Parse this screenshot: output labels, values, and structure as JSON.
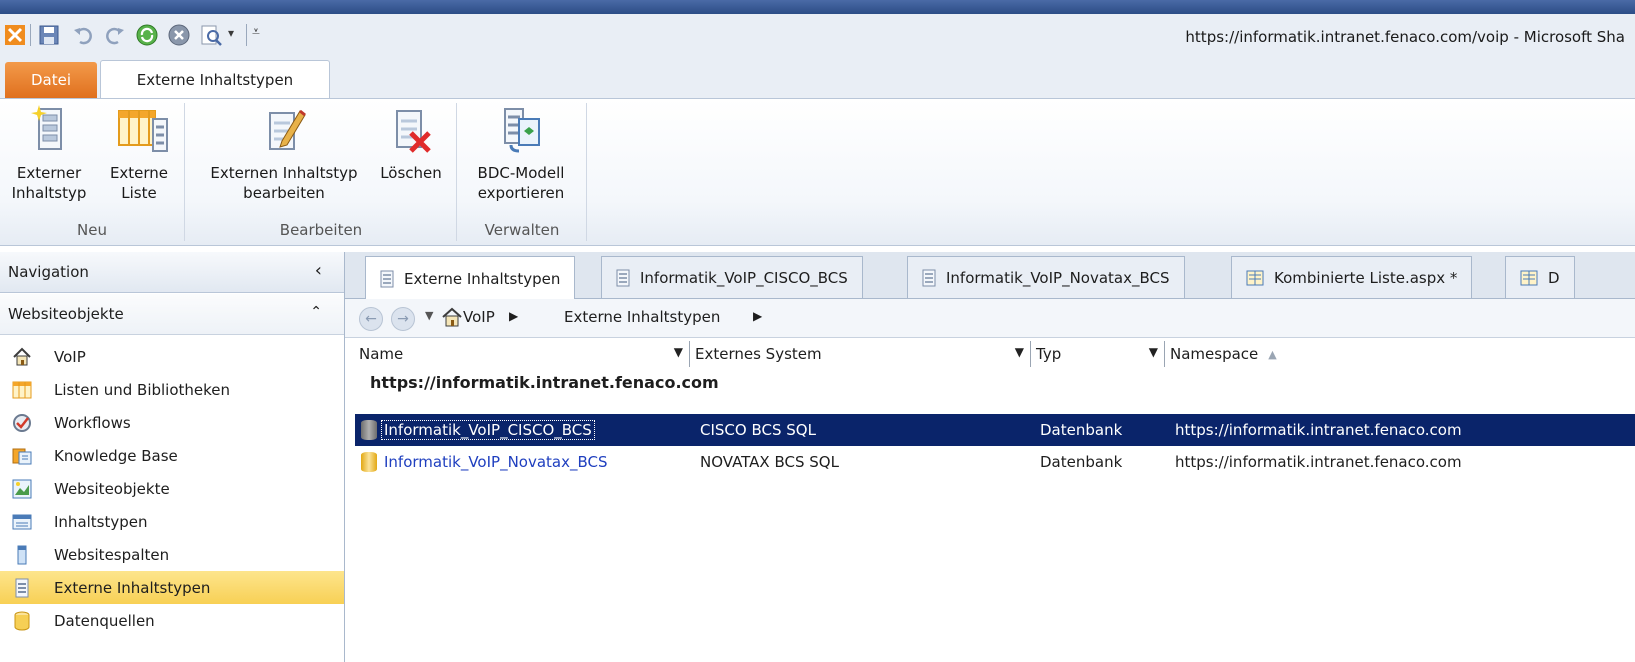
{
  "window": {
    "title": "https://informatik.intranet.fenaco.com/voip - Microsoft Sha"
  },
  "qat": {
    "icons": [
      "sharepoint-icon",
      "save-icon",
      "undo-icon",
      "redo-icon",
      "refresh-icon",
      "stop-icon",
      "preview-icon",
      "dropdown-arrow-icon",
      "customize-icon"
    ]
  },
  "ribbon": {
    "tabs": [
      {
        "label": "Datei"
      },
      {
        "label": "Externe Inhaltstypen"
      }
    ],
    "groups": [
      {
        "label": "Neu",
        "buttons": [
          {
            "line1": "Externer",
            "line2": "Inhaltstyp"
          },
          {
            "line1": "Externe",
            "line2": "Liste"
          }
        ]
      },
      {
        "label": "Bearbeiten",
        "buttons": [
          {
            "line1": "Externen Inhaltstyp",
            "line2": "bearbeiten"
          },
          {
            "line1": "Löschen",
            "line2": ""
          }
        ]
      },
      {
        "label": "Verwalten",
        "buttons": [
          {
            "line1": "BDC-Modell",
            "line2": "exportieren"
          }
        ]
      }
    ]
  },
  "nav": {
    "title": "Navigation",
    "collapse": "‹",
    "section": "Websiteobjekte",
    "section_toggle": "⌃",
    "items": [
      {
        "label": "VoIP",
        "icon": "home-icon"
      },
      {
        "label": "Listen und Bibliotheken",
        "icon": "lists-icon"
      },
      {
        "label": "Workflows",
        "icon": "workflow-icon"
      },
      {
        "label": "Knowledge Base",
        "icon": "knowledge-base-icon"
      },
      {
        "label": "Websiteobjekte",
        "icon": "site-objects-icon"
      },
      {
        "label": "Inhaltstypen",
        "icon": "content-types-icon"
      },
      {
        "label": "Websitespalten",
        "icon": "site-columns-icon"
      },
      {
        "label": "Externe Inhaltstypen",
        "icon": "external-content-types-icon",
        "selected": true
      },
      {
        "label": "Datenquellen",
        "icon": "data-sources-icon"
      }
    ]
  },
  "doc_tabs": [
    {
      "label": "Externe Inhaltstypen",
      "active": true
    },
    {
      "label": "Informatik_VoIP_CISCO_BCS"
    },
    {
      "label": "Informatik_VoIP_Novatax_BCS"
    },
    {
      "label": "Kombinierte Liste.aspx *"
    },
    {
      "label": "D"
    }
  ],
  "breadcrumb": {
    "items": [
      "VoIP",
      "Externe Inhaltstypen"
    ],
    "separator": "▶"
  },
  "grid": {
    "columns": [
      {
        "label": "Name",
        "arrow": "▼"
      },
      {
        "label": "Externes System",
        "arrow": "▼"
      },
      {
        "label": "Typ",
        "arrow": "▼"
      },
      {
        "label": "Namespace",
        "sort": "▲"
      }
    ],
    "group_header": "https://informatik.intranet.fenaco.com",
    "rows": [
      {
        "name": "Informatik_VoIP_CISCO_BCS",
        "system": "CISCO BCS SQL",
        "type": "Datenbank",
        "namespace": "https://informatik.intranet.fenaco.com",
        "selected": true
      },
      {
        "name": "Informatik_VoIP_Novatax_BCS",
        "system": "NOVATAX BCS SQL",
        "type": "Datenbank",
        "namespace": "https://informatik.intranet.fenaco.com"
      }
    ]
  },
  "colors": {
    "selection": "#0a246a",
    "nav_selected": "#f8d055",
    "file_tab": "#e0701e",
    "link": "#1f3fbf"
  }
}
